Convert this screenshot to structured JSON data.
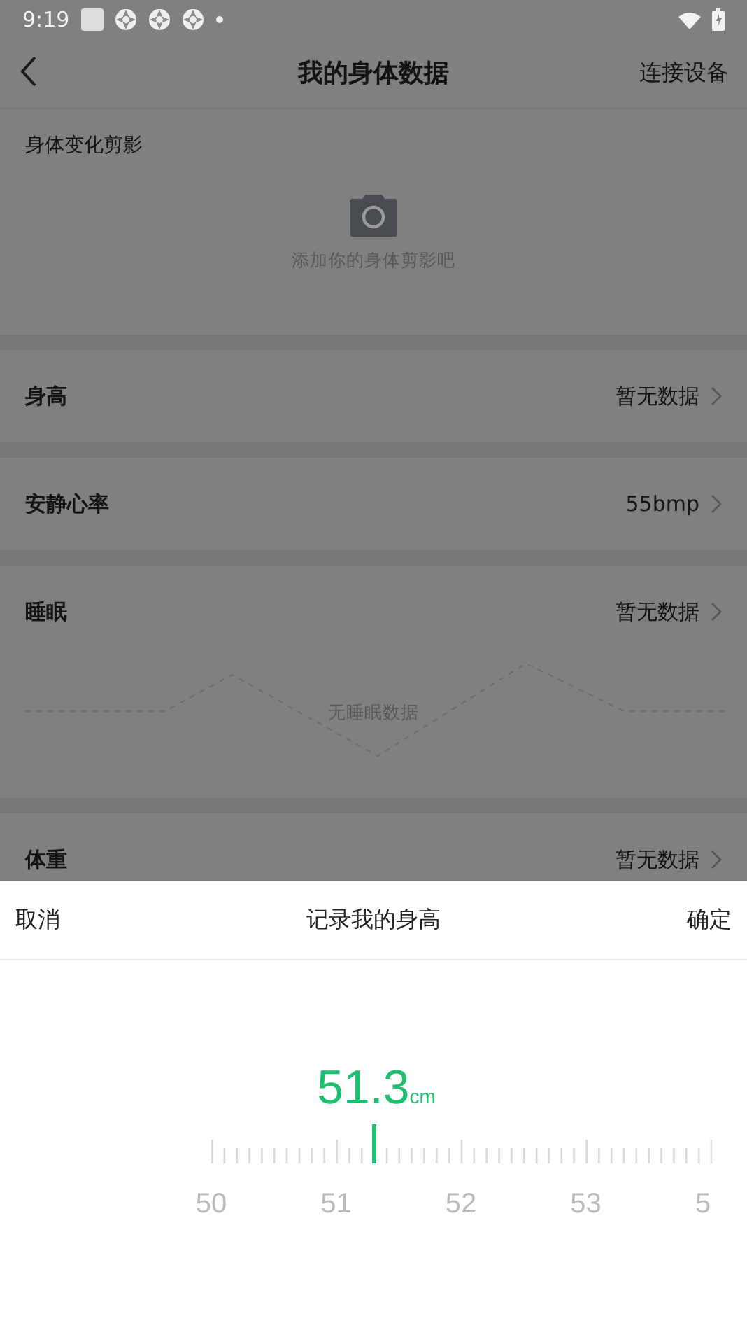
{
  "status_bar": {
    "time": "9:19"
  },
  "header": {
    "title": "我的身体数据",
    "action": "连接设备"
  },
  "silhouette": {
    "title": "身体变化剪影",
    "caption": "添加你的身体剪影吧"
  },
  "metrics": [
    {
      "kind": "row",
      "label": "身高",
      "value": "暂无数据"
    },
    {
      "kind": "row",
      "label": "安静心率",
      "value": "55bmp"
    },
    {
      "kind": "sleep",
      "label": "睡眠",
      "value": "暂无数据",
      "empty_text": "无睡眠数据"
    },
    {
      "kind": "row",
      "label": "体重",
      "value": "暂无数据"
    }
  ],
  "sheet": {
    "cancel": "取消",
    "title": "记录我的身高",
    "confirm": "确定",
    "value": "51.3",
    "unit": "cm",
    "ruler": {
      "level": 0.325,
      "labels": [
        "50",
        "51",
        "52",
        "53",
        "5"
      ]
    }
  }
}
